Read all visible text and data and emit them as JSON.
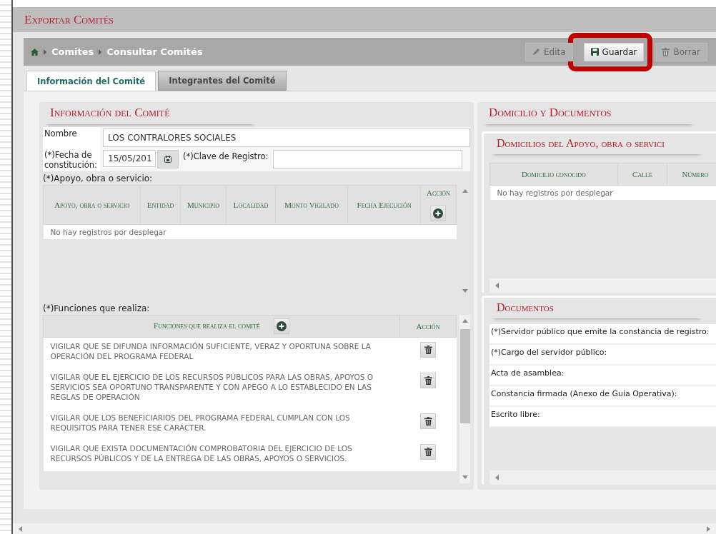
{
  "window": {
    "title": "Exportar Comités"
  },
  "breadcrumb": [
    "Comites",
    "Consultar Comités"
  ],
  "toolbar": [
    {
      "kind": "edit",
      "label": "Edita",
      "disabled": true,
      "highlighted": false
    },
    {
      "kind": "save",
      "label": "Guardar",
      "disabled": false,
      "highlighted": true
    },
    {
      "kind": "delete",
      "label": "Borrar",
      "disabled": true,
      "highlighted": false
    }
  ],
  "tabs": [
    {
      "label": "Información del Comité",
      "selected": true
    },
    {
      "label": "Integrantes del Comité",
      "selected": false
    }
  ],
  "info": {
    "heading": "Información del Comité",
    "name_label": "Nombre",
    "name_value": "LOS CONTRALORES SOCIALES",
    "date_label": "(*)Fecha de constitución:",
    "date_value": "15/05/201",
    "clave_label": "(*)Clave de Registro:",
    "apoyo": {
      "label": "(*)Apoyo, obra o servicio:",
      "columns": [
        "Apoyo, obra o servicio",
        "Entidad",
        "Municipio",
        "Localidad",
        "Monto Vigilado",
        "Fecha Ejecución",
        "Acción"
      ],
      "empty": "No hay registros por desplegar"
    },
    "funciones": {
      "label": "(*)Funciones que realiza:",
      "columns": [
        "Funciones que realiza el comité",
        "Acción"
      ],
      "rows": [
        "VIGILAR QUE SE DIFUNDA INFORMACIÓN SUFICIENTE, VERAZ Y OPORTUNA SOBRE LA OPERACIÓN DEL PROGRAMA FEDERAL",
        "VIGILAR QUE EL EJERCICIO DE LOS RECURSOS PÚBLICOS PARA LAS OBRAS, APOYOS O SERVICIOS SEA OPORTUNO TRANSPARENTE Y CON APEGO A LO ESTABLECIDO EN LAS REGLAS DE OPERACIÓN",
        "VIGILAR QUE LOS BENEFICIARIOS DEL PROGRAMA FEDERAL CUMPLAN CON LOS REQUISITOS PARA TENER ESE CARÁCTER.",
        "VIGILAR QUE EXISTA DOCUMENTACIÓN COMPROBATORIA DEL EJERCICIO DE LOS RECURSOS PÚBLICOS Y DE LA ENTREGA DE LAS OBRAS, APOYOS O SERVICIOS."
      ]
    }
  },
  "domicilio": {
    "heading": "Domicilio y Documentos",
    "domicilios": {
      "heading": "Domicilios del Apoyo, obra o servici",
      "columns": [
        "Domicilio conocido",
        "Calle",
        "Número"
      ],
      "empty": "No hay registros por desplegar"
    },
    "documentos": {
      "heading": "Documentos",
      "rows": [
        "(*)Servidor público que emite la constancia de registro:",
        "(*)Cargo del servidor público:",
        "Acta de asamblea:",
        "Constancia firmada (Anexo de Guía Operativa):",
        "Escrito libre:"
      ]
    }
  }
}
